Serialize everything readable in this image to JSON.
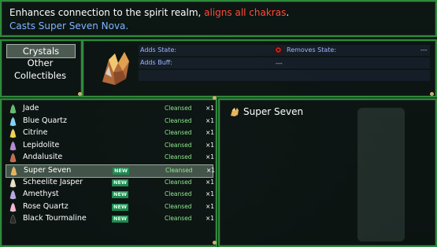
{
  "help": {
    "line1_text": "Enhances connection to the spirit realm, ",
    "line1_red": "aligns all chakras",
    "line1_end": ".",
    "line2": "Casts Super Seven Nova."
  },
  "categories": [
    {
      "label": "Crystals",
      "selected": true
    },
    {
      "label": "Other Collectibles",
      "selected": false
    }
  ],
  "status": {
    "adds_state_label": "Adds State:",
    "adds_buff_label": "Adds Buff:",
    "removes_state_label": "Removes State:",
    "adds_state_value": "",
    "adds_buff_value": "",
    "removes_state_value": "---",
    "removes_state_value2": "---"
  },
  "items": [
    {
      "name": "Jade",
      "new": false,
      "state": "Cleansed",
      "count": "×1",
      "color": "#5fbf6a"
    },
    {
      "name": "Blue Quartz",
      "new": false,
      "state": "Cleansed",
      "count": "×1",
      "color": "#7fd2ff"
    },
    {
      "name": "Citrine",
      "new": false,
      "state": "Cleansed",
      "count": "×1",
      "color": "#f1d24a"
    },
    {
      "name": "Lepidolite",
      "new": false,
      "state": "Cleansed",
      "count": "×1",
      "color": "#b58ad6"
    },
    {
      "name": "Andalusite",
      "new": false,
      "state": "Cleansed",
      "count": "×1",
      "color": "#c86a4a"
    },
    {
      "name": "Super Seven",
      "new": true,
      "state": "Cleansed",
      "count": "×1",
      "color": "#e7b35a",
      "selected": true
    },
    {
      "name": "Scheelite Jasper",
      "new": true,
      "state": "Cleansed",
      "count": "×1",
      "color": "#e8e0c8"
    },
    {
      "name": "Amethyst",
      "new": true,
      "state": "Cleansed",
      "count": "×1",
      "color": "#b9a6e6"
    },
    {
      "name": "Rose Quartz",
      "new": true,
      "state": "Cleansed",
      "count": "×1",
      "color": "#f3b7d2"
    },
    {
      "name": "Black Tourmaline",
      "new": true,
      "state": "Cleansed",
      "count": "×1",
      "color": "#2b2b2b"
    }
  ],
  "new_badge": "NEW",
  "detail": {
    "name": "Super Seven"
  },
  "colors": {
    "frame": "#2f8a3c",
    "accent_red": "#ff4a3a",
    "accent_blue": "#7fb6ff",
    "cleansed": "#8ee68f"
  }
}
